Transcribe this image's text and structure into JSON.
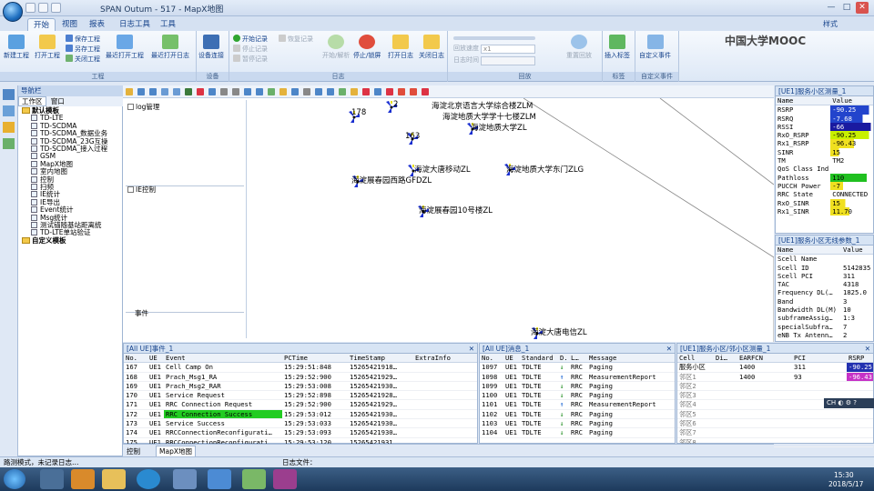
{
  "window": {
    "title": "SPAN Outum - 517 - MapX地图",
    "minimize": "—",
    "maximize": "□",
    "close": "✕",
    "style_menu": "样式"
  },
  "ribbon_tabs": [
    "开始",
    "视图",
    "报表",
    "日志工具",
    "工具"
  ],
  "ribbon": {
    "project": {
      "label": "工程",
      "new": "新建工程",
      "open": "打开工程",
      "save": "保存工程",
      "save_as": "另存工程",
      "close": "关闭工程",
      "recent_open": "最近打开工程",
      "recent_log": "最近打开日志"
    },
    "device": {
      "label": "设备",
      "connect": "设备连接"
    },
    "log": {
      "label": "日志",
      "start": "开始记录",
      "stop": "停止记录",
      "pause": "暂停记录",
      "resume": "恢复记录",
      "start_parse": "开始/解析",
      "stop_lock": "停止/锁屏",
      "open_log": "打开日志",
      "close_log": "关闭日志"
    },
    "playback": {
      "label": "回放",
      "speed_label": "回放速度",
      "speed_value": "x1",
      "time_label": "日志时间",
      "reset": "重置回放"
    },
    "tag": {
      "label": "标签",
      "insert": "插入标签"
    },
    "event": {
      "label": "自定义事件",
      "custom": "自定义事件"
    }
  },
  "brand": "中国大学MOOC",
  "nav": {
    "header": "导航栏",
    "tab_workspace": "工作区",
    "tab_window": "窗口",
    "tree": [
      "默认模板",
      "TD-LTE",
      "TD-SCDMA",
      "TD-SCDMA_数据业务",
      "TD-SCDMA_23G互操",
      "TD-SCDMA_接入过程",
      "GSM",
      "MapX地图",
      "室内地图",
      "控制",
      "扫频",
      "IE统计",
      "IE导出",
      "Event统计",
      "Msg统计",
      "测试锚随基站距离统",
      "TD-LTE单站验证",
      "自定义模板"
    ]
  },
  "map": {
    "panel_labels": {
      "log_mgmt": "log管理",
      "ie_ctrl": "IE控制",
      "event": "事件"
    },
    "sites": [
      "海淀北京语言大学综合楼ZLM",
      "海淀地质大学学十七楼ZLM",
      "海淀地质大学ZL",
      "海淀大唐移动ZL",
      "海淀地质大学东门ZLG",
      "海淀展春园西路GFDZL",
      "海淀展春园10号楼ZL",
      "海淀大唐电信ZL",
      "163"
    ],
    "fragments": {
      "a": "178",
      "b": "2"
    },
    "bottom_tabs": [
      "控制",
      "MapX地图"
    ]
  },
  "serving_cell": {
    "title": "[UE1]服务小区测量_1",
    "columns": [
      "Name",
      "Value"
    ],
    "rows": [
      [
        "RSRP",
        "-90.25"
      ],
      [
        "RSRQ",
        "-7.68"
      ],
      [
        "RSSI",
        "-66"
      ],
      [
        "RxO_RSRP",
        "-90.25"
      ],
      [
        "Rx1_RSRP",
        "-96.43"
      ],
      [
        "SINR",
        "15"
      ],
      [
        "TM",
        "TM2"
      ],
      [
        "QoS Class Ind",
        ""
      ],
      [
        "Pathloss",
        "110"
      ],
      [
        "PUCCH Power",
        "-7"
      ],
      [
        "RRC State",
        "CONNECTED"
      ],
      [
        "RxO_SINR",
        "15"
      ],
      [
        "Rx1_SINR",
        "11.70"
      ]
    ],
    "bar_fill": [
      0.9,
      0.75,
      0.95,
      0.9,
      0.55,
      0.2,
      0,
      0,
      0.85,
      0.3,
      0,
      0.35,
      0.45
    ],
    "bar_colors": [
      "#2244cc",
      "#2244cc",
      "#1a1aa0",
      "#c8f000",
      "#f0e020",
      "#f0e020",
      "",
      "",
      "#20c020",
      "#f0e020",
      "",
      "#f0e020",
      "#f0e020"
    ]
  },
  "radio_params": {
    "title": "[UE1]服务小区无线参数_1",
    "columns": [
      "Name",
      "Value"
    ],
    "rows": [
      [
        "Scell Name",
        ""
      ],
      [
        "Scell ID",
        "5142835"
      ],
      [
        "Scell PCI",
        "311"
      ],
      [
        "TAC",
        "4318"
      ],
      [
        "Frequency DL(…",
        "1825.0"
      ],
      [
        "Band",
        "3"
      ],
      [
        "Bandwidth DL(M)",
        "10"
      ],
      [
        "subframeAssig…",
        "1:3"
      ],
      [
        "specialSubfra…",
        "7"
      ],
      [
        "eNB Tx Antenn…",
        "2"
      ]
    ]
  },
  "events": {
    "title": "[All UE]事件_1",
    "columns": [
      "No.",
      "UE",
      "Event",
      "PCTime",
      "TimeStamp",
      "ExtraInfo"
    ],
    "rows": [
      [
        "167",
        "UE1",
        "Cell Camp On",
        "15:29:51:848",
        "15265421918…",
        ""
      ],
      [
        "168",
        "UE1",
        "Prach_Msg1_RA",
        "15:29:52:900",
        "15265421929…",
        ""
      ],
      [
        "169",
        "UE1",
        "Prach_Msg2_RAR",
        "15:29:53:008",
        "15265421930…",
        ""
      ],
      [
        "170",
        "UE1",
        "Service Request",
        "15:29:52:898",
        "15265421928…",
        ""
      ],
      [
        "171",
        "UE1",
        "RRC Connection Request",
        "15:29:52:900",
        "15265421929…",
        ""
      ],
      [
        "172",
        "UE1",
        "RRC Connection Success",
        "15:29:53:012",
        "15265421930…",
        ""
      ],
      [
        "173",
        "UE1",
        "Service Success",
        "15:29:53:033",
        "15265421930…",
        ""
      ],
      [
        "174",
        "UE1",
        "RRCConnectionReconfigurati…",
        "15:29:53:093",
        "15265421930…",
        ""
      ],
      [
        "175",
        "UE1",
        "RRCConnectionReconfigurati…",
        "15:29:53:120",
        "15265421931…",
        ""
      ]
    ],
    "highlight_row": 5,
    "highlight_color": "#22cc22"
  },
  "messages": {
    "title": "[All UE]消息_1",
    "columns": [
      "No.",
      "UE",
      "Standard",
      "D.",
      "L…",
      "Message"
    ],
    "rows": [
      [
        "1097",
        "UE1",
        "TDLTE",
        "↓",
        "RRC",
        "Paging"
      ],
      [
        "1098",
        "UE1",
        "TDLTE",
        "↑",
        "RRC",
        "MeasurementReport"
      ],
      [
        "1099",
        "UE1",
        "TDLTE",
        "↓",
        "RRC",
        "Paging"
      ],
      [
        "1100",
        "UE1",
        "TDLTE",
        "↓",
        "RRC",
        "Paging"
      ],
      [
        "1101",
        "UE1",
        "TDLTE",
        "↑",
        "RRC",
        "MeasurementReport"
      ],
      [
        "1102",
        "UE1",
        "TDLTE",
        "↓",
        "RRC",
        "Paging"
      ],
      [
        "1103",
        "UE1",
        "TDLTE",
        "↓",
        "RRC",
        "Paging"
      ],
      [
        "1104",
        "UE1",
        "TDLTE",
        "↓",
        "RRC",
        "Paging"
      ]
    ]
  },
  "neighbors": {
    "title": "[UE1]服务小区/邻小区测量_1",
    "columns": [
      "Cell",
      "Di…",
      "EARFCN",
      "PCI",
      "RSRP"
    ],
    "rows": [
      [
        "服务小区",
        "",
        "1400",
        "311",
        "-90.25"
      ],
      [
        "邻区1",
        "",
        "1400",
        "93",
        "-96.43"
      ],
      [
        "邻区2",
        "",
        "",
        "",
        ""
      ],
      [
        "邻区3",
        "",
        "",
        "",
        ""
      ],
      [
        "邻区4",
        "",
        "",
        "",
        ""
      ],
      [
        "邻区5",
        "",
        "",
        "",
        ""
      ],
      [
        "邻区6",
        "",
        "",
        "",
        ""
      ],
      [
        "邻区7",
        "",
        "",
        "",
        ""
      ],
      [
        "邻区8",
        "",
        "",
        "",
        ""
      ]
    ]
  },
  "status": {
    "left": "路测模式，未记录日志…",
    "log_file": "日志文件："
  },
  "ime": {
    "lang": "CH"
  },
  "clock": {
    "time": "15:30",
    "date": "2018/5/17"
  }
}
